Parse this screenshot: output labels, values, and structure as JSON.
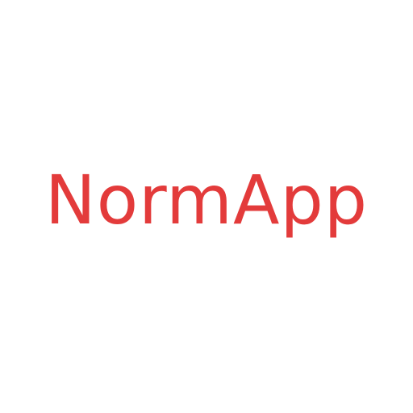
{
  "logo": {
    "text": "NormApp",
    "color": "#e33b3b"
  },
  "background_color": "#ffffff"
}
